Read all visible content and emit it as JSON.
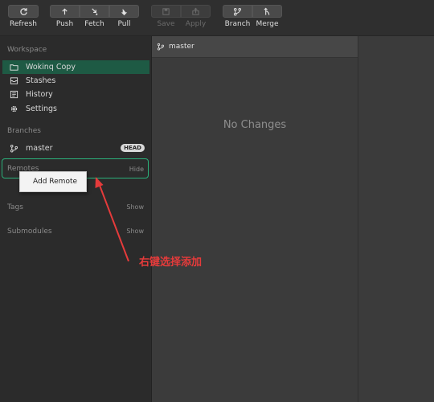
{
  "toolbar": {
    "refresh": "Refresh",
    "push": "Push",
    "fetch": "Fetch",
    "pull": "Pull",
    "save": "Save",
    "apply": "Apply",
    "branch": "Branch",
    "merge": "Merge"
  },
  "sidebar": {
    "workspace_title": "Workspace",
    "workspace_items": [
      {
        "label": "Wokinq Copy",
        "icon": "folder-icon"
      },
      {
        "label": "Stashes",
        "icon": "stash-icon"
      },
      {
        "label": "History",
        "icon": "history-icon"
      },
      {
        "label": "Settings",
        "icon": "gear-icon"
      }
    ],
    "branches_title": "Branches",
    "branch": {
      "label": "master",
      "badge": "HEAD"
    },
    "remotes_title": "Remotes",
    "remotes_action": "Hide",
    "tags_title": "Tags",
    "tags_action": "Show",
    "submodules_title": "Submodules",
    "submodules_action": "Show"
  },
  "context_menu": {
    "add_remote": "Add Remote"
  },
  "main": {
    "branch_label": "master",
    "empty_state": "No Changes"
  },
  "annotation": {
    "text": "右键选择添加",
    "color": "#e53b3b"
  },
  "colors": {
    "selected": "#1e5a44",
    "highlight_outline": "#2bb07a"
  }
}
